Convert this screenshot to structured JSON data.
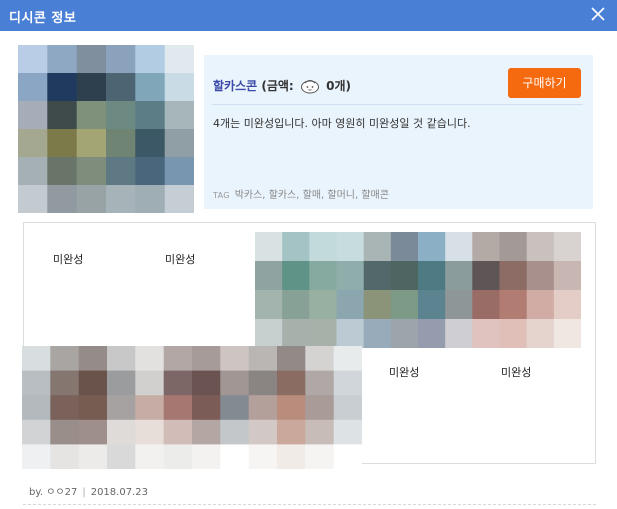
{
  "window": {
    "title": "디시콘 정보"
  },
  "con": {
    "name": "할카스콘",
    "price_prefix": "(금액:",
    "price_value": "0개)",
    "buy_label": "구매하기",
    "description": "4개는 미완성입니다. 아마 영원히 미완성일 것 같습니다.",
    "tag_label": "TAG",
    "tags": "박카스, 할카스, 할매, 할머니, 할매콘"
  },
  "preview": {
    "labels": [
      "미완성",
      "미완성",
      "미완성",
      "미완성"
    ]
  },
  "footer": {
    "author": "by. ㅇㅇ27",
    "date": "2018.07.23"
  },
  "colors": {
    "titlebar": "#4a7fd6",
    "buy_button": "#f56a0f",
    "info_bg": "#eaf4fc",
    "con_name": "#3b4aa8"
  },
  "icons": {
    "close": "close-icon",
    "coin": "coin-icon"
  }
}
